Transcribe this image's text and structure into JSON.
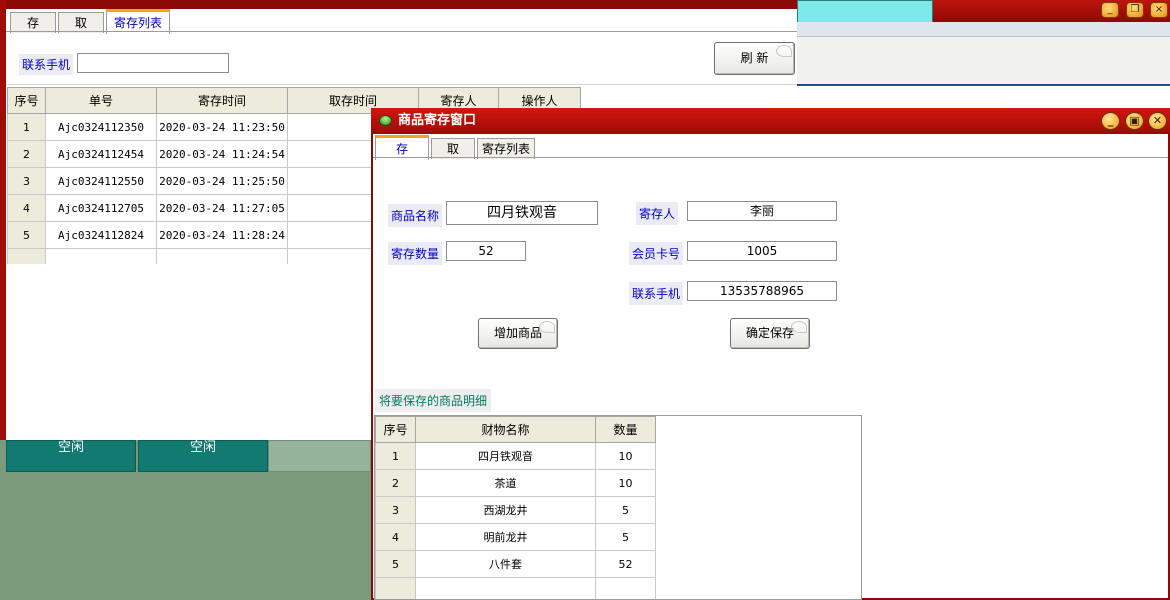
{
  "background_app": {
    "window_buttons": [
      "_",
      "❐",
      "×"
    ],
    "tiles": [
      {
        "label": "空闲"
      },
      {
        "label": "空闲"
      }
    ]
  },
  "list_window": {
    "tabs": [
      "存",
      "取",
      "寄存列表"
    ],
    "active_tab": 2,
    "phone_label": "联系手机",
    "phone_value": "",
    "refresh_label": "刷 新",
    "columns": [
      "序号",
      "单号",
      "寄存时间",
      "取存时间",
      "寄存人",
      "操作人"
    ],
    "rows": [
      {
        "seq": "1",
        "order": "Ajc0324112350",
        "time": "2020-03-24 11:23:50"
      },
      {
        "seq": "2",
        "order": "Ajc0324112454",
        "time": "2020-03-24 11:24:54"
      },
      {
        "seq": "3",
        "order": "Ajc0324112550",
        "time": "2020-03-24 11:25:50"
      },
      {
        "seq": "4",
        "order": "Ajc0324112705",
        "time": "2020-03-24 11:27:05"
      },
      {
        "seq": "5",
        "order": "Ajc0324112824",
        "time": "2020-03-24 11:28:24"
      }
    ]
  },
  "deposit_window": {
    "title": "商品寄存窗口",
    "window_buttons": [
      "_",
      "▣",
      "✕"
    ],
    "tabs": [
      "存",
      "取",
      "寄存列表"
    ],
    "active_tab": 0,
    "form": {
      "product_name_label": "商品名称",
      "product_name_value": "四月铁观音",
      "qty_label": "寄存数量",
      "qty_value": "52",
      "depositor_label": "寄存人",
      "depositor_value": "李丽",
      "member_label": "会员卡号",
      "member_value": "1005",
      "phone_label": "联系手机",
      "phone_value": "13535788965"
    },
    "add_button": "增加商品",
    "save_button": "确定保存",
    "detail_label": "将要保存的商品明细",
    "detail_columns": [
      "序号",
      "财物名称",
      "数量"
    ],
    "detail_rows": [
      {
        "seq": "1",
        "name": "四月铁观音",
        "qty": "10"
      },
      {
        "seq": "2",
        "name": "茶道",
        "qty": "10"
      },
      {
        "seq": "3",
        "name": "西湖龙井",
        "qty": "5"
      },
      {
        "seq": "4",
        "name": "明前龙井",
        "qty": "5"
      },
      {
        "seq": "5",
        "name": "八件套",
        "qty": "52"
      }
    ]
  }
}
